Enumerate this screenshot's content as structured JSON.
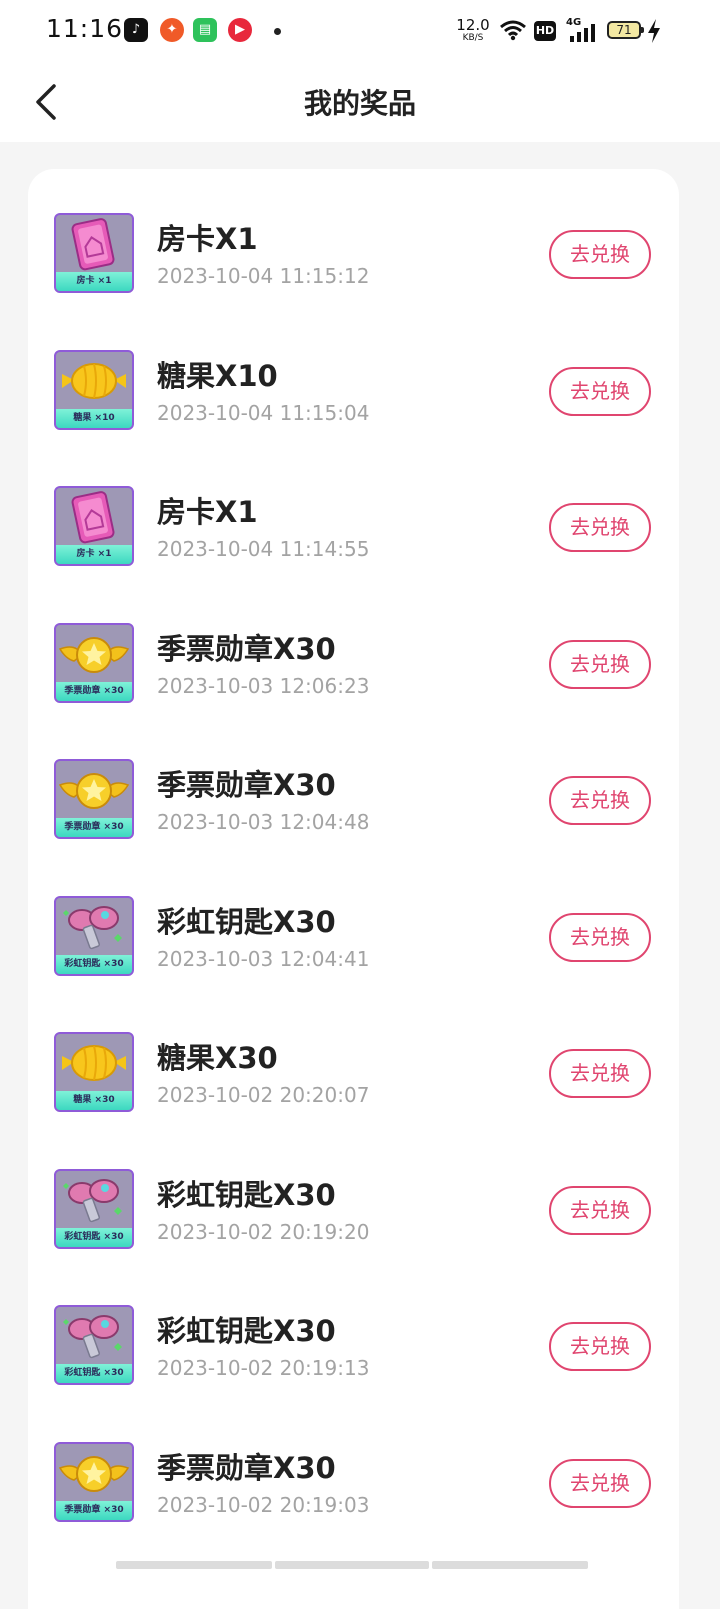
{
  "status_bar": {
    "time": "11:16",
    "network_speed_value": "12.0",
    "network_speed_unit": "KB/S",
    "hd_label": "HD",
    "signal_label": "4G",
    "battery": "71"
  },
  "header": {
    "title": "我的奖品"
  },
  "prizes": [
    {
      "name": "房卡X1",
      "time": "2023-10-04 11:15:12",
      "caption": "房卡 ×1",
      "icon": "room-card-icon",
      "button": "去兑换"
    },
    {
      "name": "糖果X10",
      "time": "2023-10-04 11:15:04",
      "caption": "糖果 ×10",
      "icon": "candy-icon",
      "button": "去兑换"
    },
    {
      "name": "房卡X1",
      "time": "2023-10-04 11:14:55",
      "caption": "房卡 ×1",
      "icon": "room-card-icon",
      "button": "去兑换"
    },
    {
      "name": "季票勋章X30",
      "time": "2023-10-03 12:06:23",
      "caption": "季票勋章 ×30",
      "icon": "medal-icon",
      "button": "去兑换"
    },
    {
      "name": "季票勋章X30",
      "time": "2023-10-03 12:04:48",
      "caption": "季票勋章 ×30",
      "icon": "medal-icon",
      "button": "去兑换"
    },
    {
      "name": "彩虹钥匙X30",
      "time": "2023-10-03 12:04:41",
      "caption": "彩虹钥匙 ×30",
      "icon": "key-icon",
      "button": "去兑换"
    },
    {
      "name": "糖果X30",
      "time": "2023-10-02 20:20:07",
      "caption": "糖果 ×30",
      "icon": "candy-icon",
      "button": "去兑换"
    },
    {
      "name": "彩虹钥匙X30",
      "time": "2023-10-02 20:19:20",
      "caption": "彩虹钥匙 ×30",
      "icon": "key-icon",
      "button": "去兑换"
    },
    {
      "name": "彩虹钥匙X30",
      "time": "2023-10-02 20:19:13",
      "caption": "彩虹钥匙 ×30",
      "icon": "key-icon",
      "button": "去兑换"
    },
    {
      "name": "季票勋章X30",
      "time": "2023-10-02 20:19:03",
      "caption": "季票勋章 ×30",
      "icon": "medal-icon",
      "button": "去兑换"
    }
  ],
  "colors": {
    "accent": "#e0456f",
    "thumb_border": "#8f5bd8",
    "caption_bg": "#3cd8c0"
  }
}
